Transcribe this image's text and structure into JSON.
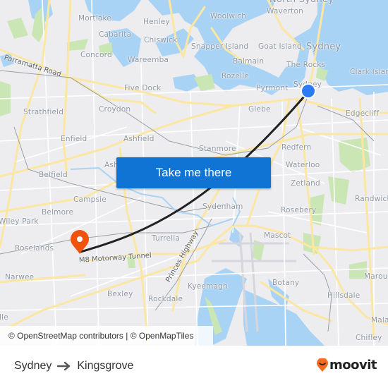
{
  "map": {
    "places": [
      {
        "name": "North Sydney",
        "big": true
      },
      {
        "name": "Waverton"
      },
      {
        "name": "Woolwich"
      },
      {
        "name": "Mortlake"
      },
      {
        "name": "Henley"
      },
      {
        "name": "Cabarita"
      },
      {
        "name": "Chiswick"
      },
      {
        "name": "Concord"
      },
      {
        "name": "Wareemba"
      },
      {
        "name": "Snapper Island"
      },
      {
        "name": "Goat Island"
      },
      {
        "name": "Sydney",
        "big": true
      },
      {
        "name": "Balmain"
      },
      {
        "name": "The Rocks"
      },
      {
        "name": "Clark Island"
      },
      {
        "name": "Rozelle"
      },
      {
        "name": "Pyrmont"
      },
      {
        "name": "Sydney"
      },
      {
        "name": "Five Dock"
      },
      {
        "name": "Glebe"
      },
      {
        "name": "Edgecliff"
      },
      {
        "name": "Strathfield"
      },
      {
        "name": "Croydon"
      },
      {
        "name": "Enfield"
      },
      {
        "name": "Ashfield"
      },
      {
        "name": "Stanmore"
      },
      {
        "name": "Redfern"
      },
      {
        "name": "Ashbury"
      },
      {
        "name": "Waterloo"
      },
      {
        "name": "Belfield"
      },
      {
        "name": "Zetland"
      },
      {
        "name": "Randwick"
      },
      {
        "name": "Campsie"
      },
      {
        "name": "Sydenham"
      },
      {
        "name": "Belmore"
      },
      {
        "name": "Rosebery"
      },
      {
        "name": "Wiley Park"
      },
      {
        "name": "Mascot"
      },
      {
        "name": "Roselands"
      },
      {
        "name": "Turrella"
      },
      {
        "name": "Maroubra"
      },
      {
        "name": "Narwee"
      },
      {
        "name": "Kyeemagh"
      },
      {
        "name": "Botany"
      },
      {
        "name": "Bexley"
      },
      {
        "name": "Hillsdale"
      },
      {
        "name": "Rockdale"
      },
      {
        "name": "Malabar"
      },
      {
        "name": "Hurstville"
      },
      {
        "name": "Chifley"
      }
    ],
    "roads": [
      {
        "name": "Parramatta Road"
      },
      {
        "name": "M8 Motorway Tunnel"
      },
      {
        "name": "Princes Highway"
      }
    ],
    "origin_marker": {
      "label": "Sydney",
      "color": "#2b7cf4"
    },
    "destination_marker": {
      "label": "Kingsgrove",
      "color": "#f0520f"
    },
    "route_color": "#222222"
  },
  "cta": {
    "label": "Take me there",
    "color": "#0f74d4"
  },
  "attribution": "© OpenStreetMap contributors | © OpenMapTiles",
  "footer": {
    "origin": "Sydney",
    "destination": "Kingsgrove",
    "arrow_icon": "arrow-right-icon",
    "brand": "moovit",
    "brand_color": "#f26b21"
  }
}
